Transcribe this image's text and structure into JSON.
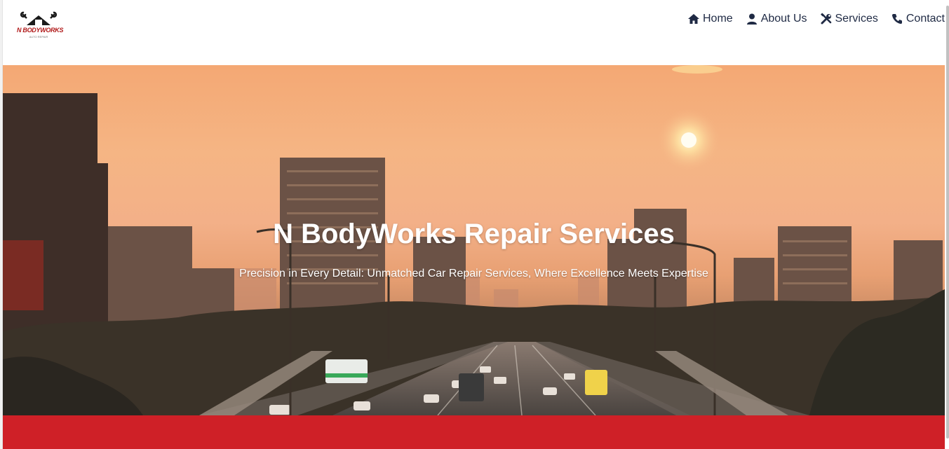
{
  "brand": {
    "logo_text": "N BODYWORKS",
    "logo_sub": "AUTO REPAIR"
  },
  "nav": {
    "items": [
      {
        "label": "Home",
        "icon": "home-icon"
      },
      {
        "label": "About Us",
        "icon": "user-icon"
      },
      {
        "label": "Services",
        "icon": "tools-icon"
      },
      {
        "label": "Contact",
        "icon": "phone-icon"
      }
    ]
  },
  "hero": {
    "title": "N BodyWorks Repair Services",
    "tagline": "Precision in Every Detail: Unmatched Car Repair Services, Where Excellence Meets Expertise"
  },
  "colors": {
    "nav_text": "#1f2a44",
    "accent_red": "#cf2027",
    "logo_red": "#b01818"
  }
}
